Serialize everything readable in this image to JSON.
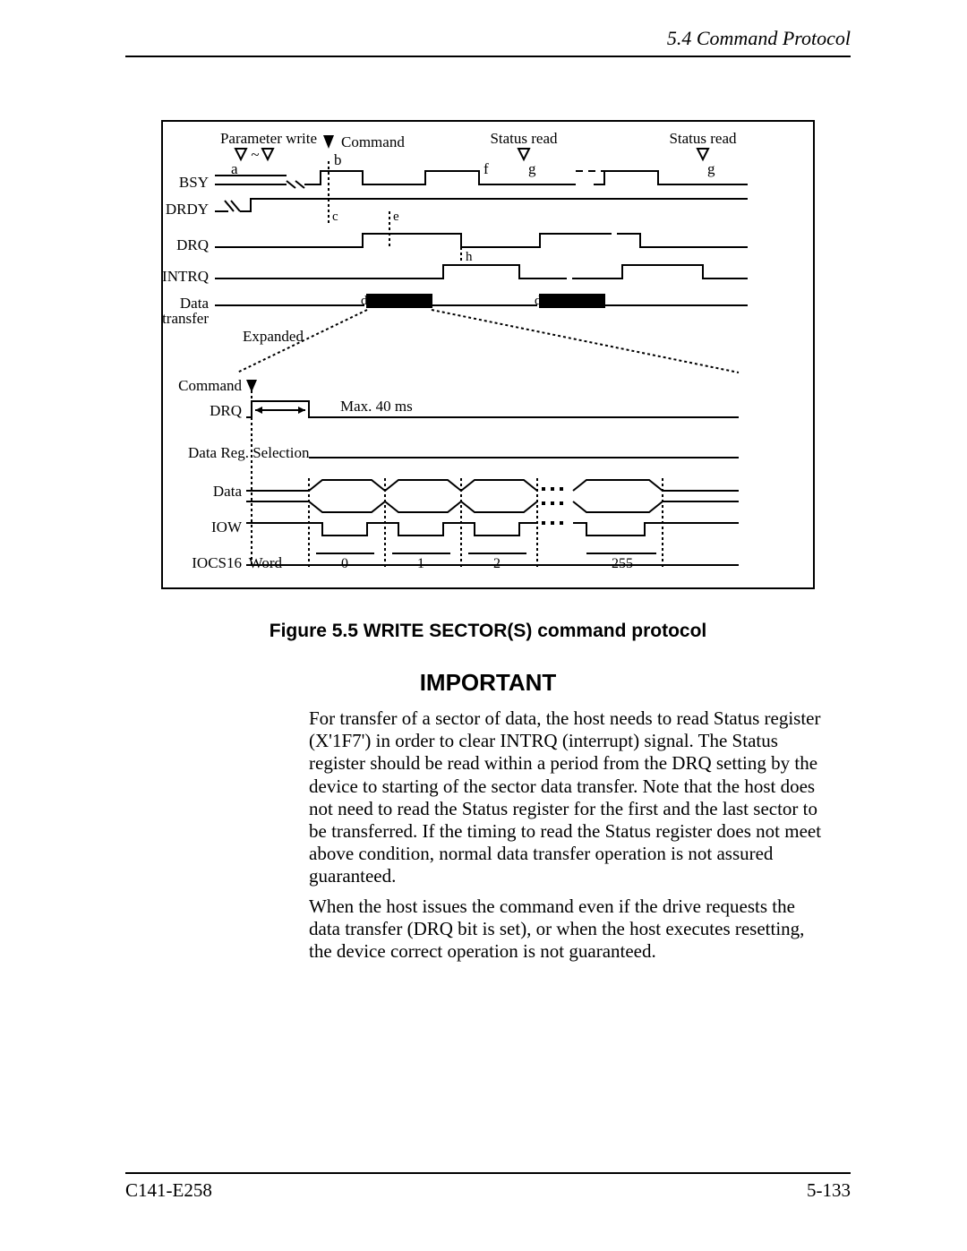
{
  "header": {
    "section": "5.4  Command Protocol"
  },
  "diagram": {
    "top_labels": {
      "param_write": "Parameter write",
      "command": "Command",
      "status_read_1": "Status read",
      "status_read_2": "Status read"
    },
    "signals": {
      "bsy": "BSY",
      "drdy": "DRDY",
      "drq": "DRQ",
      "intrq": "INTRQ",
      "data_transfer": "Data\ntransfer",
      "expanded": "Expanded"
    },
    "time_labels": {
      "a": "a",
      "b": "b",
      "c": "c",
      "d": "d",
      "e": "e",
      "f": "f",
      "g": "g",
      "h": "h"
    },
    "expanded_section": {
      "command": "Command",
      "drq": "DRQ",
      "max_time": "Max. 40 ms",
      "data_reg_selection": "Data Reg. Selection",
      "data": "Data",
      "iow": "IOW",
      "iocs16": "IOCS16",
      "word": "Word",
      "w0": "0",
      "w1": "1",
      "w2": "2",
      "w255": "255"
    }
  },
  "figure_caption": "Figure 5.5  WRITE SECTOR(S) command protocol",
  "important": {
    "heading": "IMPORTANT",
    "para1": "For transfer of a sector of data, the host needs to read Status register (X'1F7') in order to clear INTRQ (interrupt) signal. The Status register should be read within a period from the DRQ setting by the device to starting of the sector data transfer.  Note that the host does not need to read the Status register for the first and the last sector to be transferred.  If the timing to read the Status register does not meet above condition, normal data transfer operation is not assured guaranteed.",
    "para2": "When the host issues the command even if the drive requests the data transfer (DRQ bit is set), or when the host executes resetting, the device correct operation is not guaranteed."
  },
  "footer": {
    "left": "C141-E258",
    "right": "5-133"
  }
}
